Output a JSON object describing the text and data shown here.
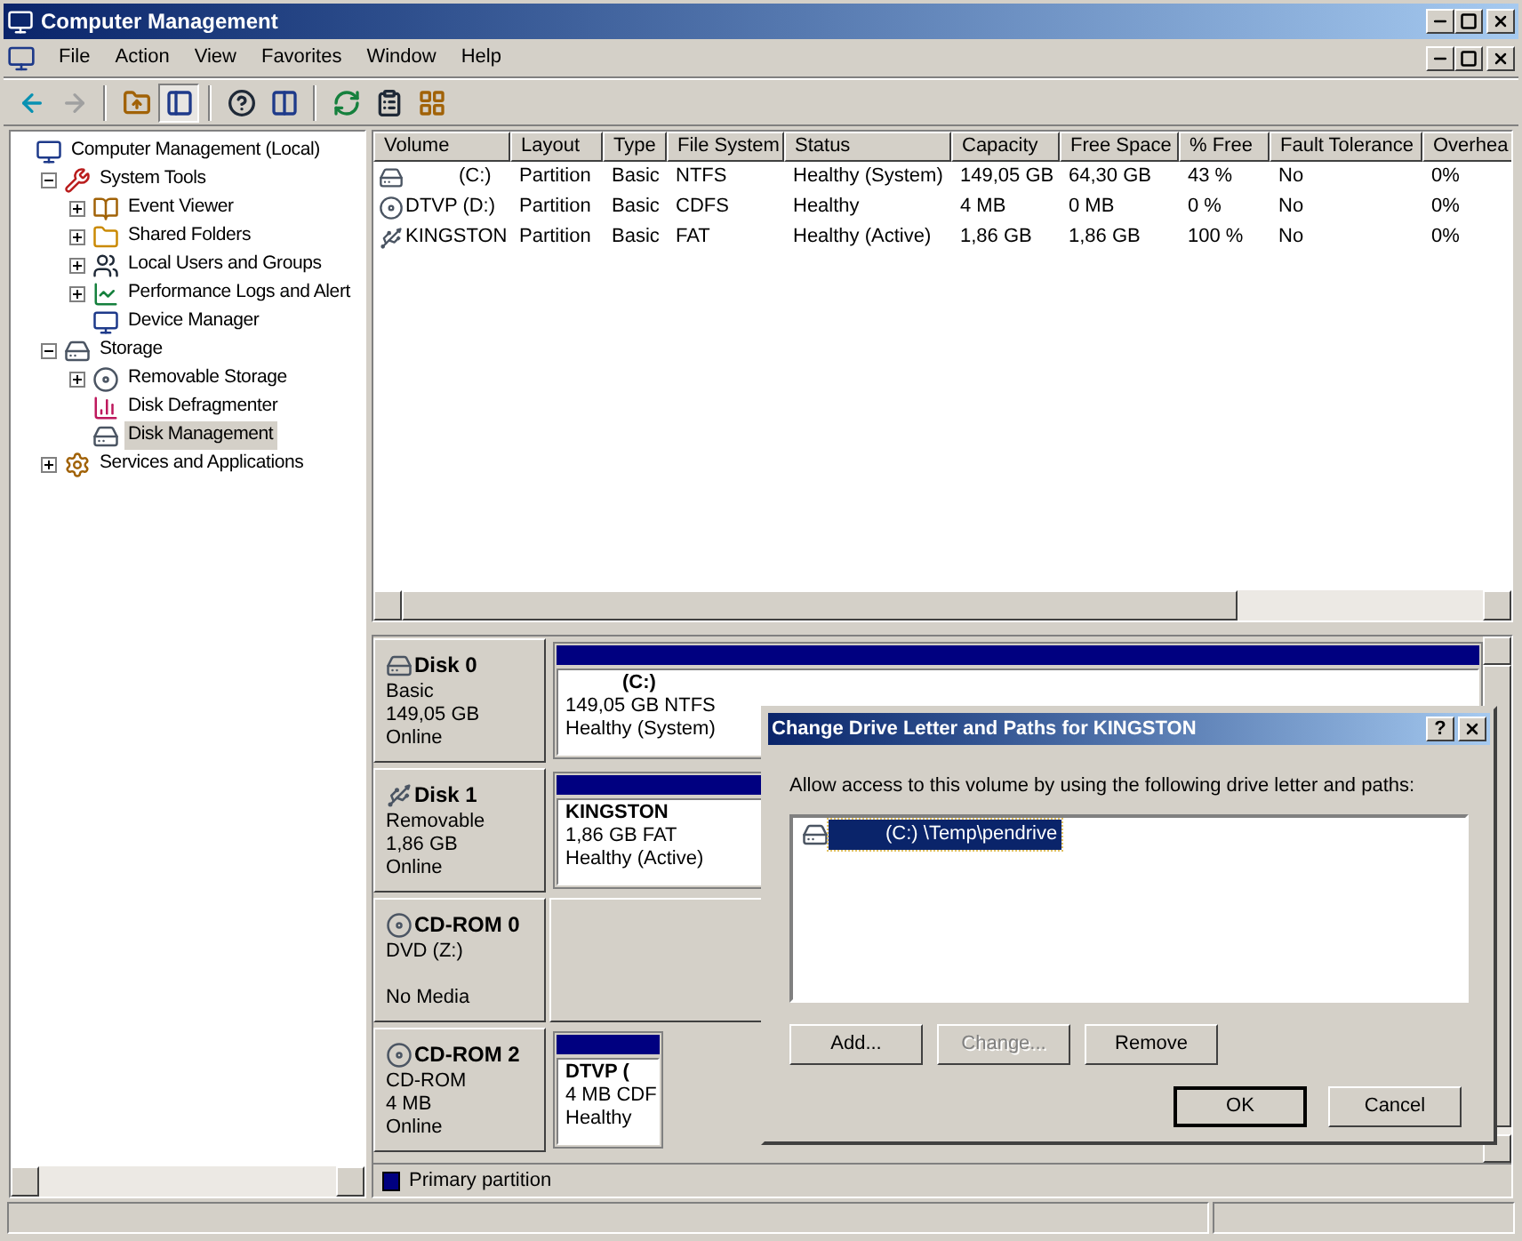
{
  "window": {
    "title": "Computer Management"
  },
  "menu": [
    "File",
    "Action",
    "View",
    "Favorites",
    "Window",
    "Help"
  ],
  "toolbar": [
    {
      "disabled": false,
      "pressed": false
    },
    {
      "disabled": true,
      "pressed": false
    },
    {
      "disabled": false,
      "pressed": false
    },
    {
      "disabled": false,
      "pressed": true
    },
    {
      "disabled": false,
      "pressed": false
    },
    {
      "disabled": false,
      "pressed": false
    },
    {
      "disabled": false,
      "pressed": false
    },
    {
      "disabled": false,
      "pressed": false
    },
    {
      "disabled": false,
      "pressed": false
    }
  ],
  "tree": [
    {
      "label": "Computer Management (Local)",
      "selected": false,
      "children": [
        {
          "label": "System Tools",
          "expanded": true,
          "selected": false,
          "children": [
            {
              "label": "Event Viewer",
              "expanded": false,
              "selected": false
            },
            {
              "label": "Shared Folders",
              "expanded": false,
              "selected": false
            },
            {
              "label": "Local Users and Groups",
              "expanded": false,
              "selected": false
            },
            {
              "label": "Performance Logs and Alert",
              "expanded": false,
              "selected": false
            },
            {
              "label": "Device Manager",
              "selected": false
            }
          ]
        },
        {
          "label": "Storage",
          "expanded": true,
          "selected": false,
          "children": [
            {
              "label": "Removable Storage",
              "expanded": false,
              "selected": false
            },
            {
              "label": "Disk Defragmenter",
              "selected": false
            },
            {
              "label": "Disk Management",
              "selected": true
            }
          ]
        },
        {
          "label": "Services and Applications",
          "expanded": false,
          "selected": false
        }
      ]
    }
  ],
  "table": {
    "columns": [
      "Volume",
      "Layout",
      "Type",
      "File System",
      "Status",
      "Capacity",
      "Free Space",
      "% Free",
      "Fault Tolerance",
      "Overhea"
    ],
    "rows": [
      {
        "kind": "hdd",
        "cells": [
          "(C:)",
          "Partition",
          "Basic",
          "NTFS",
          "Healthy (System)",
          "149,05 GB",
          "64,30 GB",
          "43 %",
          "No",
          "0%"
        ]
      },
      {
        "kind": "cd",
        "cells": [
          "DTVP (D:)",
          "Partition",
          "Basic",
          "CDFS",
          "Healthy",
          "4 MB",
          "0 MB",
          "0 %",
          "No",
          "0%"
        ]
      },
      {
        "kind": "usb",
        "cells": [
          "KINGSTON",
          "Partition",
          "Basic",
          "FAT",
          "Healthy (Active)",
          "1,86 GB",
          "1,86 GB",
          "100 %",
          "No",
          "0%"
        ]
      }
    ]
  },
  "disks": [
    {
      "kind": "hdd",
      "name": "Disk 0",
      "lines": [
        "Basic",
        "149,05 GB",
        "Online"
      ],
      "partitions": [
        {
          "label": "(C:)",
          "size": "149,05 GB NTFS",
          "status": "Healthy (System)"
        }
      ]
    },
    {
      "kind": "usb",
      "name": "Disk 1",
      "lines": [
        "Removable",
        "1,86 GB",
        "Online"
      ],
      "partitions": [
        {
          "label": "KINGSTON",
          "size": "1,86 GB FAT",
          "status": "Healthy (Active)"
        }
      ]
    },
    {
      "kind": "cdrom",
      "name": "CD-ROM 0",
      "lines": [
        "DVD (Z:)",
        "No Media"
      ]
    },
    {
      "kind": "cdrom",
      "name": "CD-ROM 2",
      "lines": [
        "CD-ROM",
        "4 MB",
        "Online"
      ],
      "partitions": [
        {
          "label": "DTVP  (",
          "size": "4 MB CDF",
          "status": "Healthy"
        }
      ]
    }
  ],
  "legend": {
    "label": "Primary partition",
    "color": "#000080"
  },
  "dialog": {
    "title": "Change Drive Letter and Paths for KINGSTON",
    "help": "?",
    "prompt": "Allow access to this volume by using the following drive letter and paths:",
    "paths": [
      {
        "label": "(C:) \\Temp\\pendrive",
        "selected": true
      }
    ],
    "buttons": [
      {
        "label": "Add...",
        "disabled": false
      },
      {
        "label": "Change...",
        "disabled": true
      },
      {
        "label": "Remove",
        "disabled": false
      }
    ],
    "ok": "OK",
    "cancel": "Cancel"
  }
}
